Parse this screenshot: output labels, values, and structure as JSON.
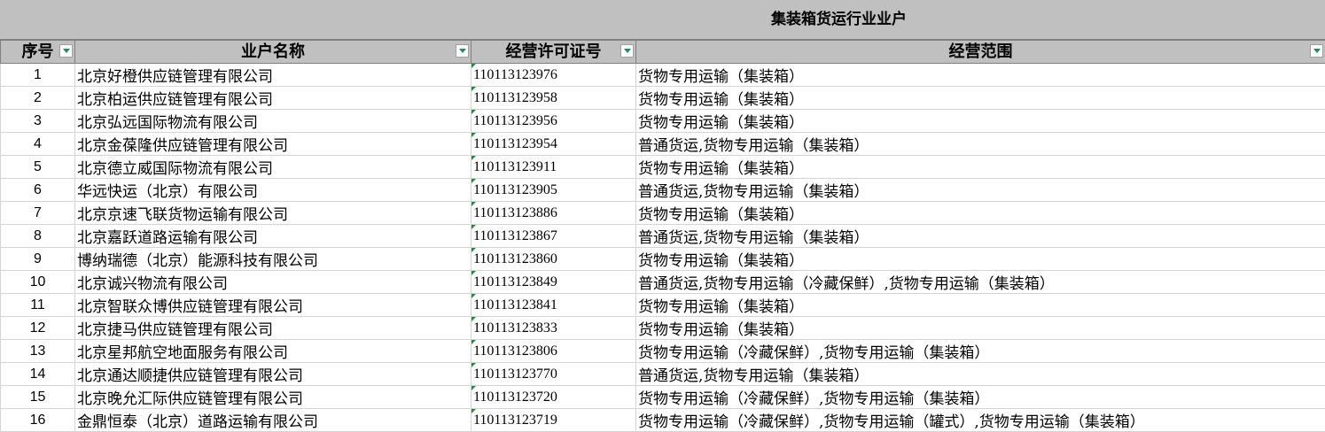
{
  "sheet": {
    "title": "集装箱货运行业业户",
    "headers": {
      "seq": "序号",
      "name": "业户名称",
      "license": "经营许可证号",
      "scope": "经营范围"
    },
    "rows": [
      {
        "seq": "1",
        "name": "北京好橙供应链管理有限公司",
        "license": "110113123976",
        "scope": "货物专用运输（集装箱）"
      },
      {
        "seq": "2",
        "name": "北京柏运供应链管理有限公司",
        "license": "110113123958",
        "scope": "货物专用运输（集装箱）"
      },
      {
        "seq": "3",
        "name": "北京弘远国际物流有限公司",
        "license": "110113123956",
        "scope": "货物专用运输（集装箱）"
      },
      {
        "seq": "4",
        "name": "北京金葆隆供应链管理有限公司",
        "license": "110113123954",
        "scope": "普通货运,货物专用运输（集装箱）"
      },
      {
        "seq": "5",
        "name": "北京德立威国际物流有限公司",
        "license": "110113123911",
        "scope": "货物专用运输（集装箱）"
      },
      {
        "seq": "6",
        "name": "华远快运（北京）有限公司",
        "license": "110113123905",
        "scope": "普通货运,货物专用运输（集装箱）"
      },
      {
        "seq": "7",
        "name": "北京京速飞联货物运输有限公司",
        "license": "110113123886",
        "scope": "货物专用运输（集装箱）"
      },
      {
        "seq": "8",
        "name": "北京嘉跃道路运输有限公司",
        "license": "110113123867",
        "scope": "普通货运,货物专用运输（集装箱）"
      },
      {
        "seq": "9",
        "name": "博纳瑞德（北京）能源科技有限公司",
        "license": "110113123860",
        "scope": "货物专用运输（集装箱）"
      },
      {
        "seq": "10",
        "name": "北京诚兴物流有限公司",
        "license": "110113123849",
        "scope": "普通货运,货物专用运输（冷藏保鲜）,货物专用运输（集装箱）"
      },
      {
        "seq": "11",
        "name": "北京智联众博供应链管理有限公司",
        "license": "110113123841",
        "scope": "货物专用运输（集装箱）"
      },
      {
        "seq": "12",
        "name": "北京捷马供应链管理有限公司",
        "license": "110113123833",
        "scope": "货物专用运输（集装箱）"
      },
      {
        "seq": "13",
        "name": "北京星邦航空地面服务有限公司",
        "license": "110113123806",
        "scope": "货物专用运输（冷藏保鲜）,货物专用运输（集装箱）"
      },
      {
        "seq": "14",
        "name": "北京通达顺捷供应链管理有限公司",
        "license": "110113123770",
        "scope": "普通货运,货物专用运输（集装箱）"
      },
      {
        "seq": "15",
        "name": "北京晚允汇际供应链管理有限公司",
        "license": "110113123720",
        "scope": "货物专用运输（冷藏保鲜）,货物专用运输（集装箱）"
      },
      {
        "seq": "16",
        "name": "金鼎恒泰（北京）道路运输有限公司",
        "license": "110113123719",
        "scope": "货物专用运输（冷藏保鲜）,货物专用运输（罐式）,货物专用运输（集装箱）"
      }
    ]
  }
}
